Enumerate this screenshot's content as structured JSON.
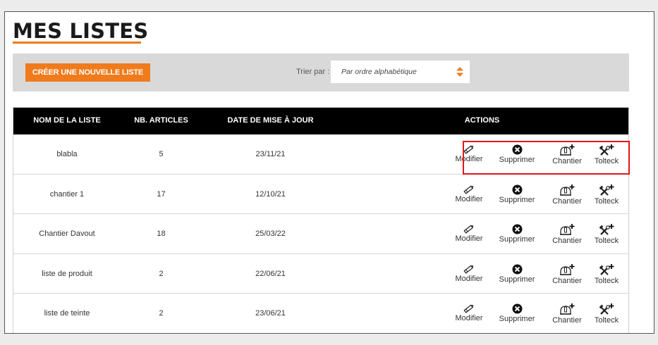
{
  "page": {
    "title": "MES LISTES",
    "accent_color": "#f07b1c",
    "highlight_color": "#e4161b"
  },
  "toolbar": {
    "create_button_label": "CRÉER UNE NOUVELLE LISTE",
    "sort_label": "Trier par :",
    "sort_value": "Par ordre alphabétique",
    "sort_icon": "sort-arrows-icon"
  },
  "table": {
    "headers": [
      "NOM DE LA LISTE",
      "NB. ARTICLES",
      "DATE DE MISE À JOUR",
      "ACTIONS"
    ],
    "action_labels": {
      "modifier": "Modifier",
      "supprimer": "Supprimer",
      "chantier": "Chantier",
      "tolteck": "Tolteck"
    },
    "action_icons": {
      "modifier": "pencil-icon",
      "supprimer": "delete-circle-icon",
      "chantier": "hardhat-add-icon",
      "tolteck": "tools-add-icon"
    },
    "rows": [
      {
        "name": "blabla",
        "count": "5",
        "date": "23/11/21",
        "highlighted": true
      },
      {
        "name": "chantier 1",
        "count": "17",
        "date": "12/10/21",
        "highlighted": false
      },
      {
        "name": "Chantier Davout",
        "count": "18",
        "date": "25/03/22",
        "highlighted": false
      },
      {
        "name": "liste de produit",
        "count": "2",
        "date": "22/06/21",
        "highlighted": false
      },
      {
        "name": "liste de teinte",
        "count": "2",
        "date": "23/06/21",
        "highlighted": false
      }
    ]
  }
}
